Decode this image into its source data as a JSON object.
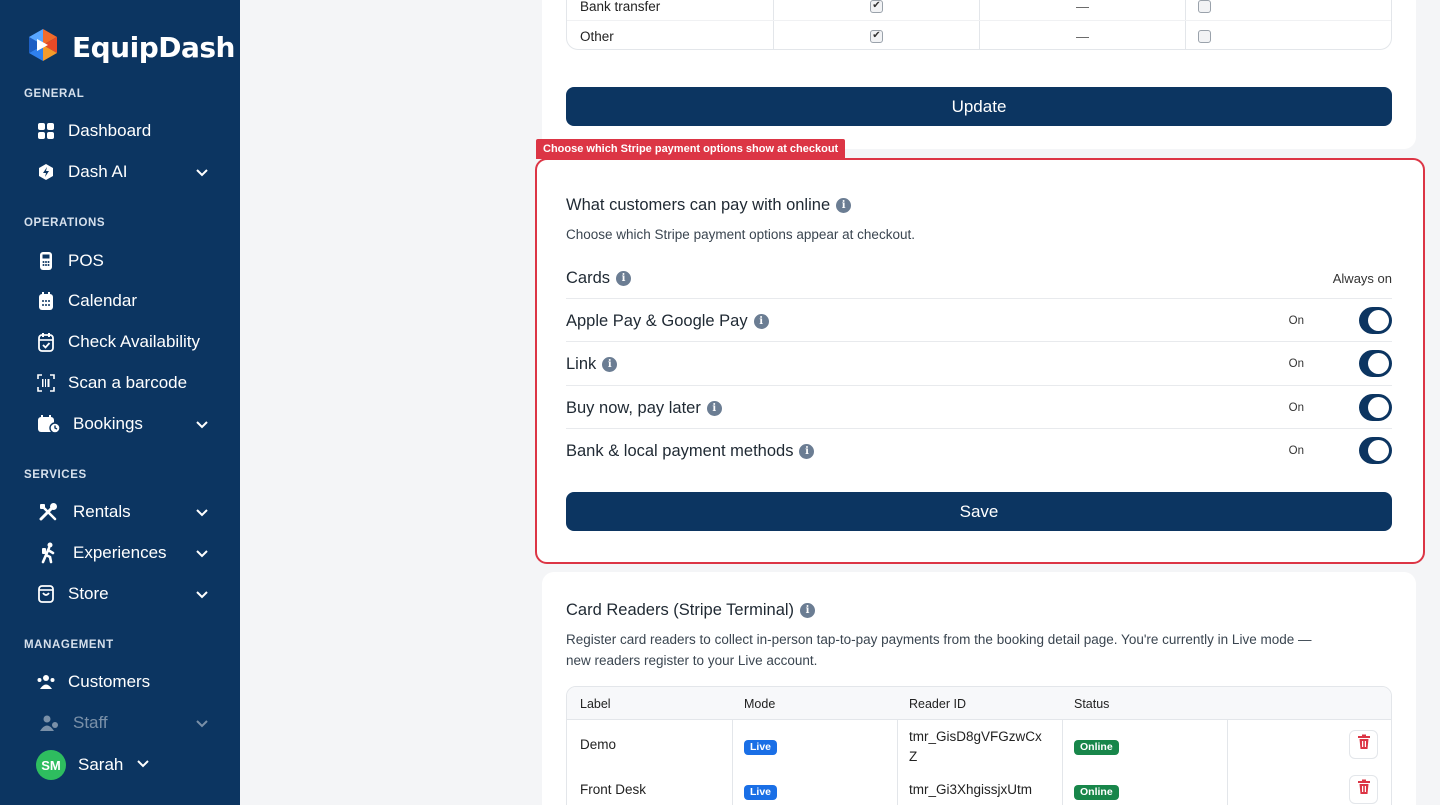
{
  "brand": {
    "name": "EquipDash"
  },
  "sidebar": {
    "sections": {
      "general": "GENERAL",
      "operations": "OPERATIONS",
      "services": "SERVICES",
      "management": "MANAGEMENT"
    },
    "items": {
      "dashboard": "Dashboard",
      "dash_ai": "Dash AI",
      "pos": "POS",
      "calendar": "Calendar",
      "check_availability": "Check Availability",
      "scan_barcode": "Scan a barcode",
      "bookings": "Bookings",
      "rentals": "Rentals",
      "experiences": "Experiences",
      "store": "Store",
      "customers": "Customers",
      "staff": "Staff"
    },
    "user": {
      "initials": "SM",
      "name": "Sarah"
    }
  },
  "payment_methods_table": {
    "rows": [
      {
        "label": "Bank transfer",
        "col2": "checked",
        "col3": "—",
        "col4": "unchecked"
      },
      {
        "label": "Other",
        "col2": "checked",
        "col3": "—",
        "col4": "unchecked"
      }
    ],
    "update_label": "Update"
  },
  "highlight": {
    "tag": "Choose which Stripe payment options show at checkout"
  },
  "online_payments": {
    "title": "What customers can pay with online",
    "description": "Choose which Stripe payment options appear at checkout.",
    "cards": {
      "label": "Cards",
      "state": "Always on"
    },
    "options": [
      {
        "label": "Apple Pay & Google Pay",
        "state": "On"
      },
      {
        "label": "Link",
        "state": "On"
      },
      {
        "label": "Buy now, pay later",
        "state": "On"
      },
      {
        "label": "Bank & local payment methods",
        "state": "On"
      }
    ],
    "save_label": "Save"
  },
  "card_readers": {
    "title": "Card Readers (Stripe Terminal)",
    "description_line1": "Register card readers to collect in-person tap-to-pay payments from the booking detail page. You're currently in Live mode —",
    "description_line2": "new readers register to your Live account.",
    "columns": {
      "label": "Label",
      "mode": "Mode",
      "reader_id": "Reader ID",
      "status": "Status"
    },
    "rows": [
      {
        "label": "Demo",
        "mode": "Live",
        "reader_id_line1": "tmr_GisD8gVFGzwCx",
        "reader_id_line2": "Z",
        "status": "Online"
      },
      {
        "label": "Front Desk",
        "mode": "Live",
        "reader_id_line1": "tmr_Gi3XhgissjxUtm",
        "reader_id_line2": "",
        "status": "Online"
      }
    ]
  },
  "colors": {
    "sidebar": "#0c3561",
    "primary": "#0c3561",
    "highlight": "#dc3545",
    "live": "#1a6fe6",
    "online": "#18864a"
  }
}
